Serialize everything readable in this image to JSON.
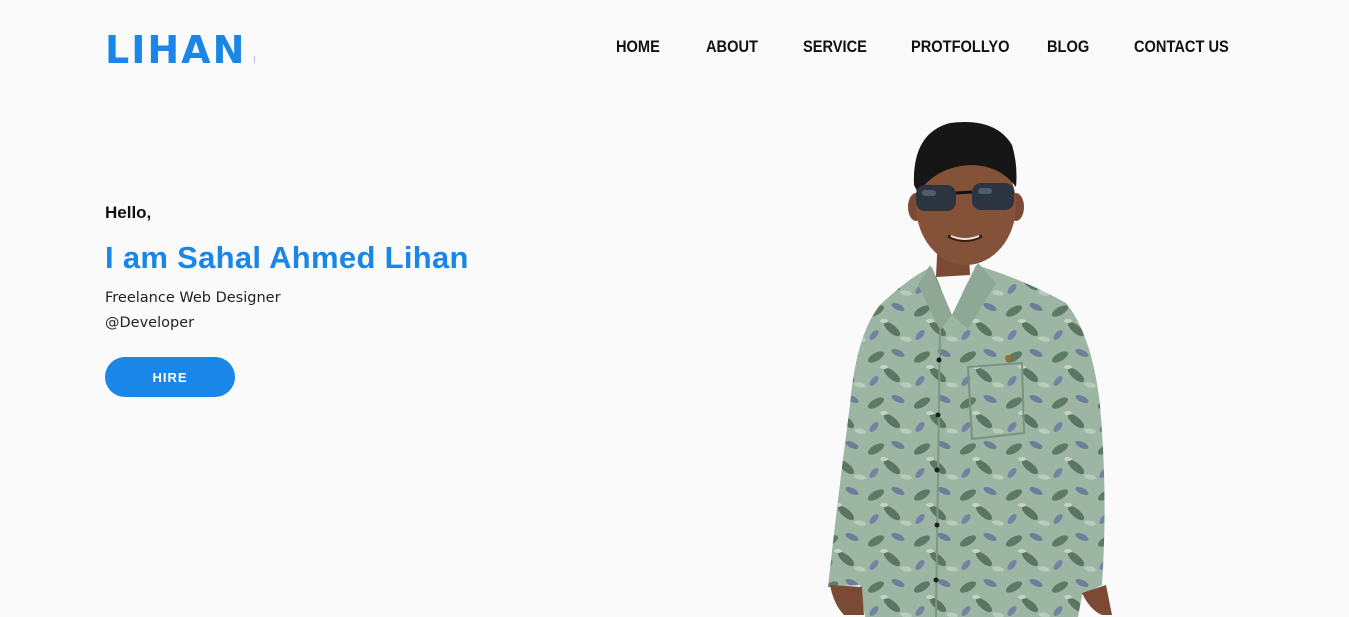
{
  "header": {
    "logo": "LIHAN",
    "nav": [
      "HOME",
      "ABOUT",
      "SERVICE",
      "PROTFOLLYO",
      "BLOG",
      "CONTACT US"
    ]
  },
  "hero": {
    "greeting": "Hello,",
    "name": "I am Sahal Ahmed Lihan",
    "role_line1": "Freelance Web Designer",
    "role_line2": "@Developer",
    "cta": "HIRE"
  },
  "colors": {
    "accent": "#1a86e8",
    "background": "#fafafa",
    "text": "#111111"
  }
}
